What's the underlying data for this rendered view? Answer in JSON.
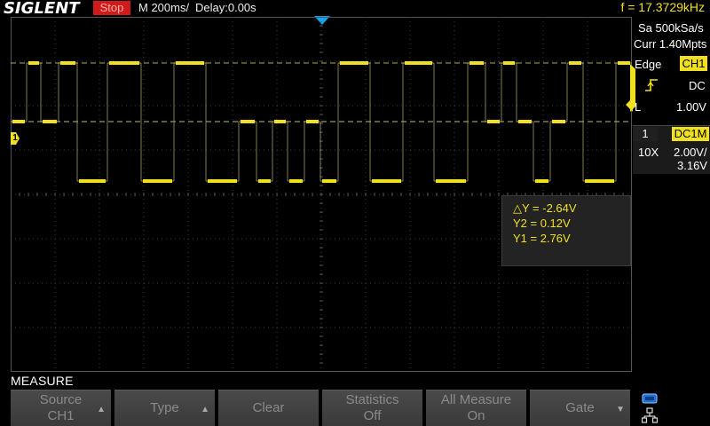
{
  "header": {
    "brand": "SIGLENT",
    "run_state": "Stop",
    "timebase": "M 200ms/",
    "delay": "Delay:0.00s",
    "frequency": "f = 17.3729kHz"
  },
  "acquisition": {
    "sample_rate": "Sa 500kSa/s",
    "memory_depth": "Curr 1.40Mpts"
  },
  "trigger": {
    "type": "Edge",
    "source": "CH1",
    "slope_icon": "rising-edge-icon",
    "coupling": "DC",
    "level_label": "L",
    "level": "1.00V"
  },
  "channel": {
    "number": "1",
    "coupling": "DC1M",
    "probe": "10X",
    "scale": "2.00V/",
    "offset": "3.16V",
    "marker_label": "1"
  },
  "cursors": {
    "delta_y": "△Y = -2.64V",
    "y2": "Y2 = 0.12V",
    "y1": "Y1 = 2.76V"
  },
  "menu": {
    "title": "MEASURE",
    "softkeys": [
      {
        "line1": "Source",
        "line2": "CH1",
        "arrow": "▲"
      },
      {
        "line1": "Type",
        "line2": "",
        "arrow": "▲"
      },
      {
        "line1": "Clear",
        "line2": "",
        "arrow": ""
      },
      {
        "line1": "Statistics",
        "line2": "Off",
        "arrow": ""
      },
      {
        "line1": "All Measure",
        "line2": "On",
        "arrow": ""
      },
      {
        "line1": "Gate",
        "line2": "",
        "arrow": "▼"
      }
    ]
  },
  "status_icons": [
    "usb-icon",
    "network-icon"
  ],
  "colors": {
    "ch1": "#f0e020",
    "trigger_marker": "#1aa3e8",
    "stop_badge": "#d11a1a",
    "background": "#000000",
    "softkey": "#444444"
  }
}
